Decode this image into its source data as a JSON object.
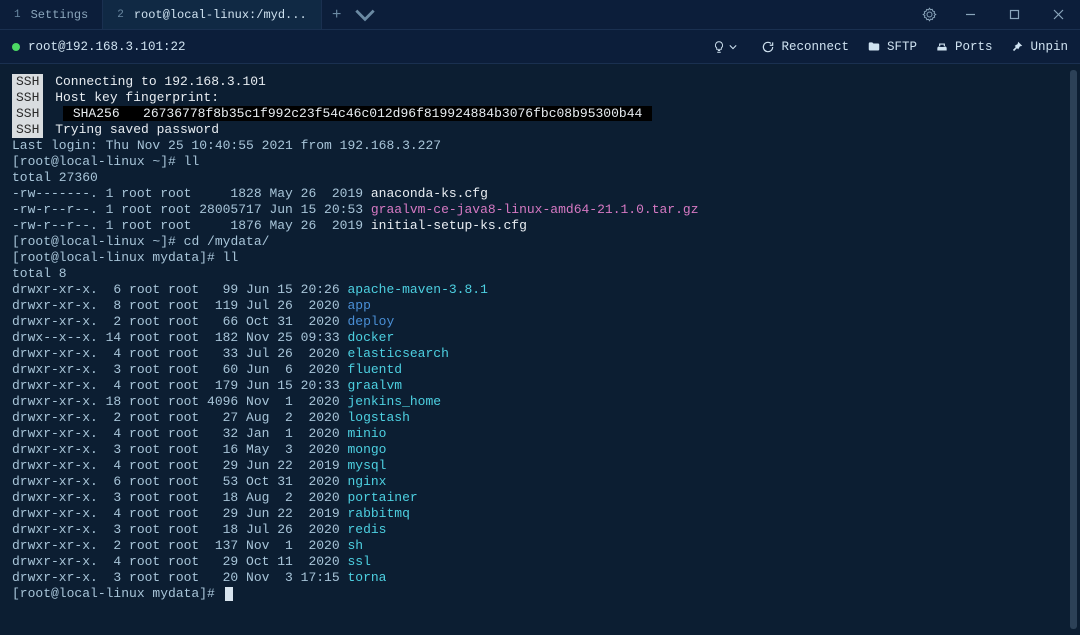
{
  "tabs": [
    {
      "index": "1",
      "label": "Settings"
    },
    {
      "index": "2",
      "label": "root@local-linux:/myd..."
    }
  ],
  "connection": "root@192.168.3.101:22",
  "actions": {
    "reconnect": "Reconnect",
    "sftp": "SFTP",
    "ports": "Ports",
    "unpin": "Unpin"
  },
  "ssh": {
    "connecting": "Connecting to 192.168.3.101",
    "fingerprint_label": "Host key fingerprint:",
    "sha_label": "SHA256",
    "sha_value": "26736778f8b35c1f992c23f54c46c012d96f819924884b3076fbc08b95300b44",
    "trying": "Trying saved password"
  },
  "last_login": "Last login: Thu Nov 25 10:40:55 2021 from 192.168.3.227",
  "prompt1": "[root@local-linux ~]# ",
  "cmd1": "ll",
  "total1": "total 27360",
  "files1": [
    {
      "perm": "-rw-------. 1 root root     1828 May 26  2019 ",
      "name": "anaconda-ks.cfg",
      "cls": "white"
    },
    {
      "perm": "-rw-r--r--. 1 root root 28005717 Jun 15 20:53 ",
      "name": "graalvm-ce-java8-linux-amd64-21.1.0.tar.gz",
      "cls": "magenta"
    },
    {
      "perm": "-rw-r--r--. 1 root root     1876 May 26  2019 ",
      "name": "initial-setup-ks.cfg",
      "cls": "white"
    }
  ],
  "prompt2": "[root@local-linux ~]# ",
  "cmd2": "cd /mydata/",
  "prompt3": "[root@local-linux mydata]# ",
  "cmd3": "ll",
  "total2": "total 8",
  "files2": [
    {
      "perm": "drwxr-xr-x.  6 root root   99 Jun 15 20:26 ",
      "name": "apache-maven-3.8.1",
      "cls": "cyan"
    },
    {
      "perm": "drwxr-xr-x.  8 root root  119 Jul 26  2020 ",
      "name": "app",
      "cls": "blue"
    },
    {
      "perm": "drwxr-xr-x.  2 root root   66 Oct 31  2020 ",
      "name": "deploy",
      "cls": "blue"
    },
    {
      "perm": "drwx--x--x. 14 root root  182 Nov 25 09:33 ",
      "name": "docker",
      "cls": "cyan"
    },
    {
      "perm": "drwxr-xr-x.  4 root root   33 Jul 26  2020 ",
      "name": "elasticsearch",
      "cls": "cyan"
    },
    {
      "perm": "drwxr-xr-x.  3 root root   60 Jun  6  2020 ",
      "name": "fluentd",
      "cls": "cyan"
    },
    {
      "perm": "drwxr-xr-x.  4 root root  179 Jun 15 20:33 ",
      "name": "graalvm",
      "cls": "cyan"
    },
    {
      "perm": "drwxr-xr-x. 18 root root 4096 Nov  1  2020 ",
      "name": "jenkins_home",
      "cls": "cyan"
    },
    {
      "perm": "drwxr-xr-x.  2 root root   27 Aug  2  2020 ",
      "name": "logstash",
      "cls": "cyan"
    },
    {
      "perm": "drwxr-xr-x.  4 root root   32 Jan  1  2020 ",
      "name": "minio",
      "cls": "cyan"
    },
    {
      "perm": "drwxr-xr-x.  3 root root   16 May  3  2020 ",
      "name": "mongo",
      "cls": "cyan"
    },
    {
      "perm": "drwxr-xr-x.  4 root root   29 Jun 22  2019 ",
      "name": "mysql",
      "cls": "cyan"
    },
    {
      "perm": "drwxr-xr-x.  6 root root   53 Oct 31  2020 ",
      "name": "nginx",
      "cls": "cyan"
    },
    {
      "perm": "drwxr-xr-x.  3 root root   18 Aug  2  2020 ",
      "name": "portainer",
      "cls": "cyan"
    },
    {
      "perm": "drwxr-xr-x.  4 root root   29 Jun 22  2019 ",
      "name": "rabbitmq",
      "cls": "cyan"
    },
    {
      "perm": "drwxr-xr-x.  3 root root   18 Jul 26  2020 ",
      "name": "redis",
      "cls": "cyan"
    },
    {
      "perm": "drwxr-xr-x.  2 root root  137 Nov  1  2020 ",
      "name": "sh",
      "cls": "cyan"
    },
    {
      "perm": "drwxr-xr-x.  4 root root   29 Oct 11  2020 ",
      "name": "ssl",
      "cls": "cyan"
    },
    {
      "perm": "drwxr-xr-x.  3 root root   20 Nov  3 17:15 ",
      "name": "torna",
      "cls": "cyan"
    }
  ],
  "prompt4": "[root@local-linux mydata]# "
}
